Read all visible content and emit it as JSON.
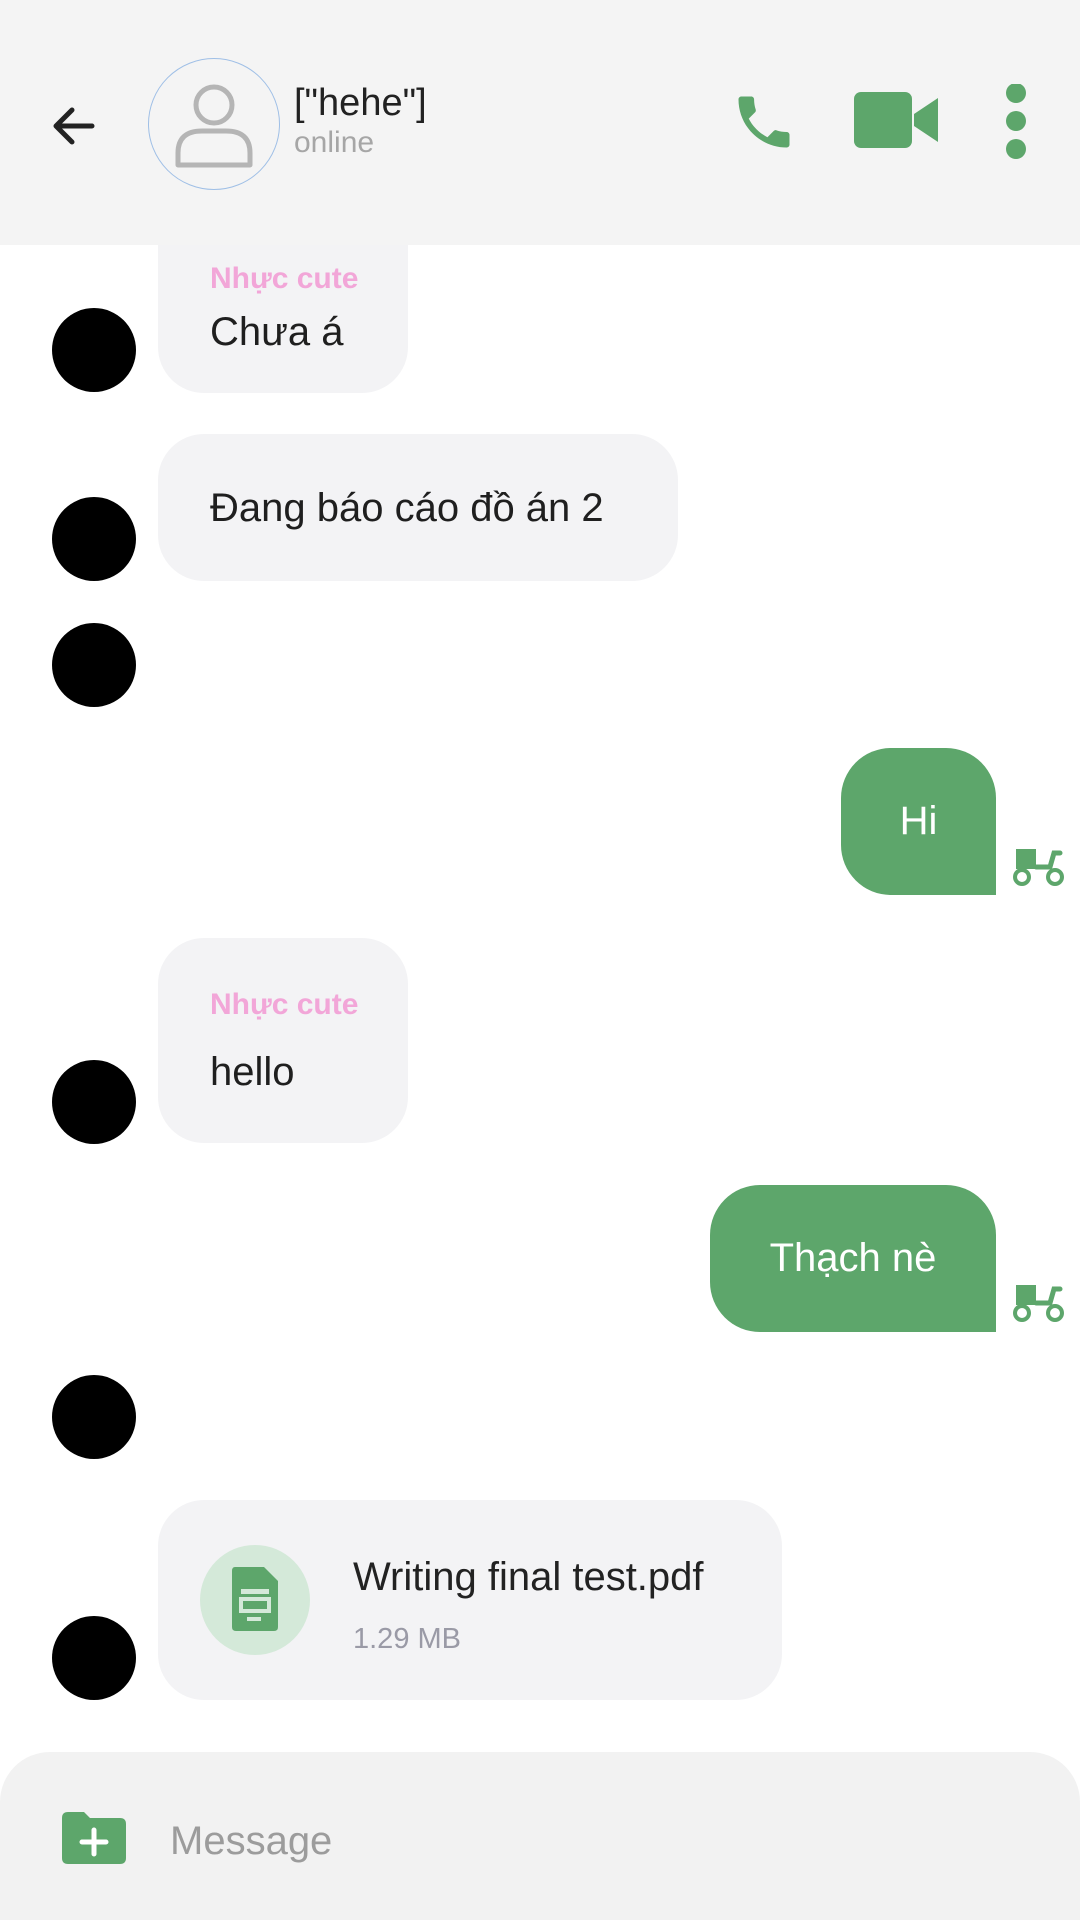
{
  "header": {
    "contact_name": "[\"hehe\"]",
    "contact_status": "online",
    "icons": [
      "back-arrow-icon",
      "user-avatar-icon",
      "phone-icon",
      "video-camera-icon",
      "more-vertical-icon"
    ]
  },
  "messages": {
    "m1": {
      "sender": "Nhực cute",
      "text": "Chưa á"
    },
    "m2": {
      "text": "Đang báo cáo đồ án 2"
    },
    "m4": {
      "text": "Hi",
      "status_icon": "scooter-icon"
    },
    "m5": {
      "sender": "Nhực cute",
      "text": "hello"
    },
    "m6": {
      "text": "Thạch nè",
      "status_icon": "scooter-icon"
    },
    "m8": {
      "file_name": "Writing final test.pdf",
      "file_size": "1.29 MB",
      "file_icon": "document-icon"
    }
  },
  "composer": {
    "placeholder": "Message",
    "attach_icon": "folder-add-icon"
  },
  "colors": {
    "accent": "#5da66b",
    "sender_name": "#f2a6d8",
    "incoming_bubble": "#f3f3f5",
    "header_bg": "#f4f4f4"
  }
}
